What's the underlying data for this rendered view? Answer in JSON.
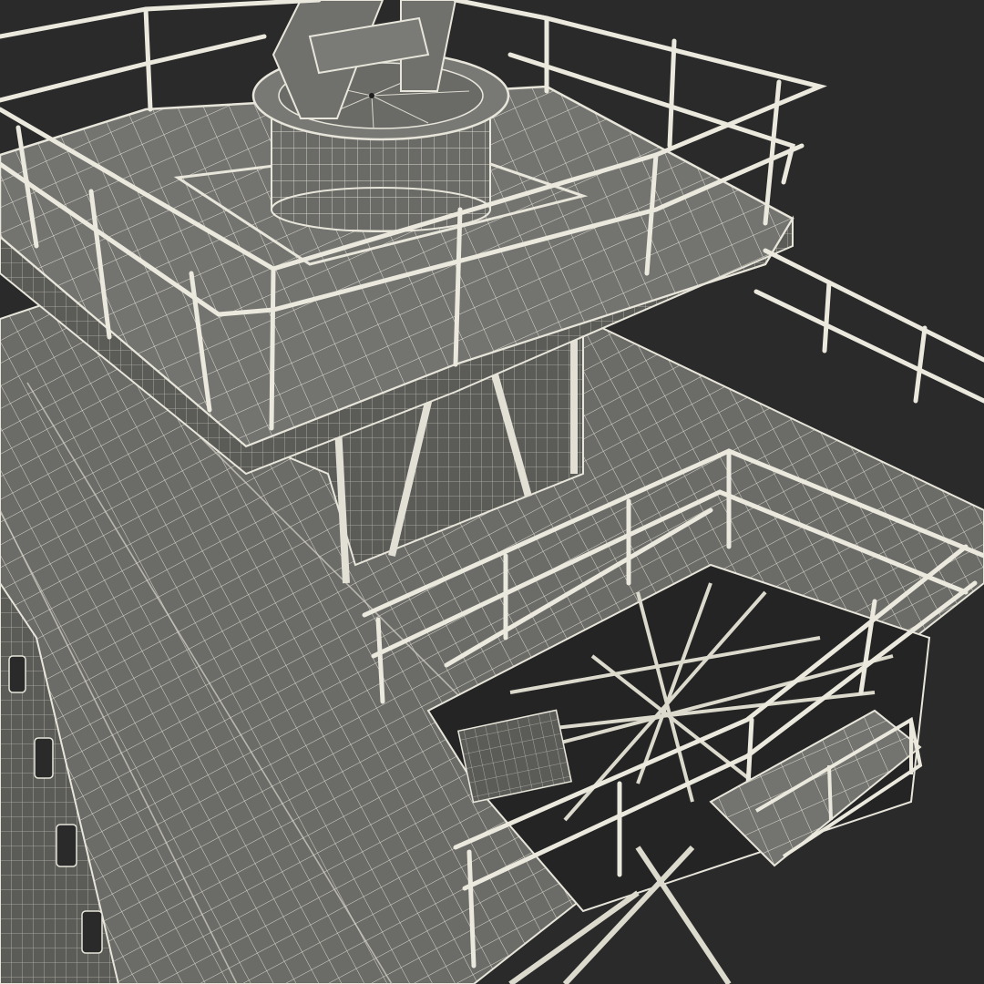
{
  "scene": {
    "subject": "wireframe-render-offshore-platform-deck",
    "colors": {
      "background": "#2a2a2a",
      "surface": "#6e6e6b",
      "surface_dark": "#5a5a57",
      "shadow": "#3e3e3c",
      "wire": "#e8e6da",
      "wire_soft": "#c9c7bb",
      "hole": "#1f1f1f"
    }
  }
}
